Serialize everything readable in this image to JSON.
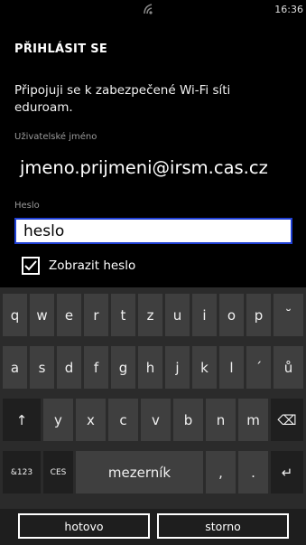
{
  "status": {
    "time": "16:36",
    "signal_icon": "wifi-icon"
  },
  "title": "PŘIHLÁSIT SE",
  "message": "Připojuji se k zabezpečené Wi-Fi síti eduroam.",
  "username": {
    "label": "Uživatelské jméno",
    "value": "jmeno.prijmeni@irsm.cas.cz"
  },
  "password": {
    "label": "Heslo",
    "value": "heslo"
  },
  "show_password": {
    "label": "Zobrazit heslo",
    "checked": true
  },
  "keyboard": {
    "row1": [
      "q",
      "w",
      "e",
      "r",
      "t",
      "z",
      "u",
      "i",
      "o",
      "p",
      "˘"
    ],
    "row2": [
      "a",
      "s",
      "d",
      "f",
      "g",
      "h",
      "j",
      "k",
      "l",
      "´",
      "ů"
    ],
    "row3": [
      "↑",
      "y",
      "x",
      "c",
      "v",
      "b",
      "n",
      "m",
      "⌫"
    ],
    "row4": [
      "&123",
      "CES",
      "mezerník",
      ",",
      ".",
      "↵"
    ]
  },
  "buttons": {
    "done": "hotovo",
    "cancel": "storno"
  }
}
